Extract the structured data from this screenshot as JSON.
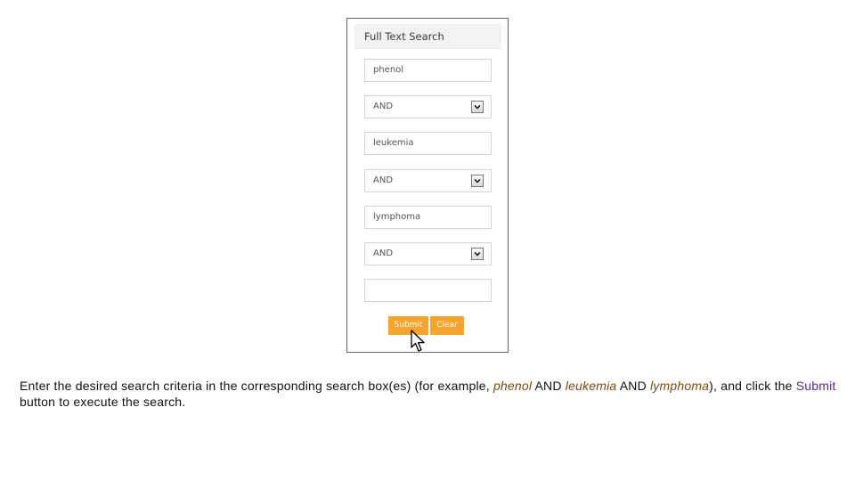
{
  "panel": {
    "title": "Full Text Search",
    "fields": [
      {
        "kind": "input",
        "value": "phenol"
      },
      {
        "kind": "select",
        "value": "AND"
      },
      {
        "kind": "input",
        "value": "leukemia"
      },
      {
        "kind": "select",
        "value": "AND"
      },
      {
        "kind": "input",
        "value": "lymphoma"
      },
      {
        "kind": "select",
        "value": "AND"
      },
      {
        "kind": "input",
        "value": ""
      }
    ],
    "submit_label": "Submit",
    "clear_label": "Clear"
  },
  "instructions": {
    "part1": "Enter the desired search criteria in the corresponding search box(es) (for example, ",
    "term1": "phenol",
    "and1": " AND ",
    "term2": "leukemia",
    "and2": " AND ",
    "term3": "lymphoma",
    "part2": "), and click the ",
    "submit_word": "Submit",
    "part3": " button to execute the search."
  },
  "colors": {
    "button": "#f5a431",
    "term_text": "#7a4a12",
    "submit_text": "#5b2a86"
  },
  "icons": [
    "chevron-down-icon",
    "mouse-pointer-icon"
  ]
}
